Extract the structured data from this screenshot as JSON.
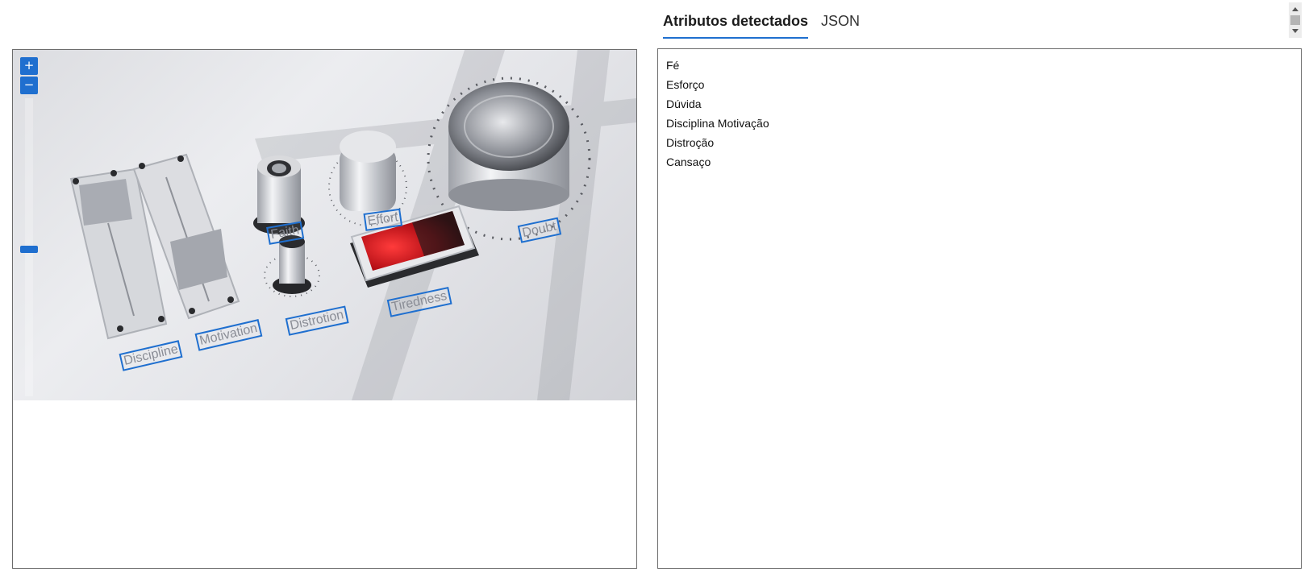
{
  "tabs": {
    "detected_attributes": "Atributos detectados",
    "json": "JSON"
  },
  "viewer": {
    "zoom_in": "+",
    "zoom_out": "−",
    "detections": [
      "Faith",
      "Effort",
      "Doubt",
      "Discipline",
      "Motivation",
      "Distrotion",
      "Tiredness"
    ]
  },
  "attributes": [
    "Fé",
    "Esforço",
    "Dúvida",
    "Disciplina Motivação",
    "Distroção",
    "Cansaço"
  ],
  "colors": {
    "accent": "#1f6fcf",
    "switch_red": "#d4161f"
  }
}
